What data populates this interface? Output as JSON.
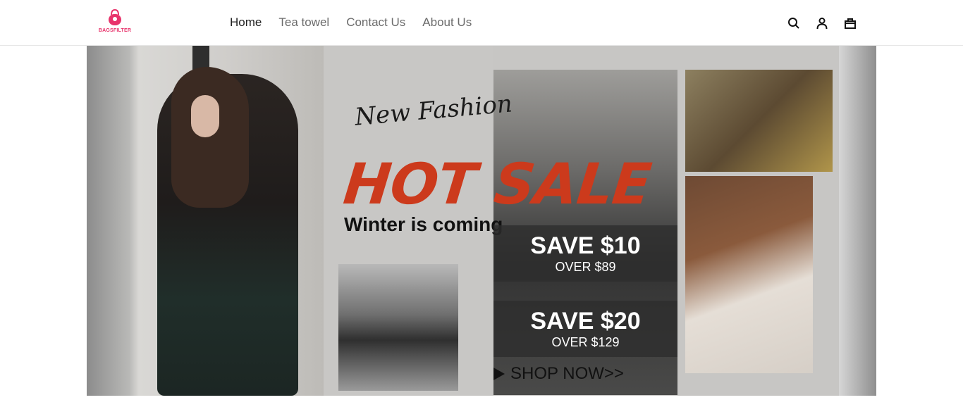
{
  "brand": {
    "name": "BAGSFILTER",
    "color": "#e8336b"
  },
  "nav": {
    "items": [
      {
        "label": "Home",
        "active": true
      },
      {
        "label": "Tea towel",
        "active": false
      },
      {
        "label": "Contact Us",
        "active": false
      },
      {
        "label": "About Us",
        "active": false
      }
    ]
  },
  "header_icons": [
    "search-icon",
    "account-icon",
    "cart-icon"
  ],
  "banner": {
    "script_text": "New Fashion",
    "headline": "HOT SALE",
    "headline_color": "#cc3a1c",
    "subline": "Winter is coming",
    "offers": [
      {
        "title": "SAVE $10",
        "condition": "OVER $89"
      },
      {
        "title": "SAVE $20",
        "condition": "OVER $129"
      }
    ],
    "cta": "SHOP NOW>>"
  }
}
